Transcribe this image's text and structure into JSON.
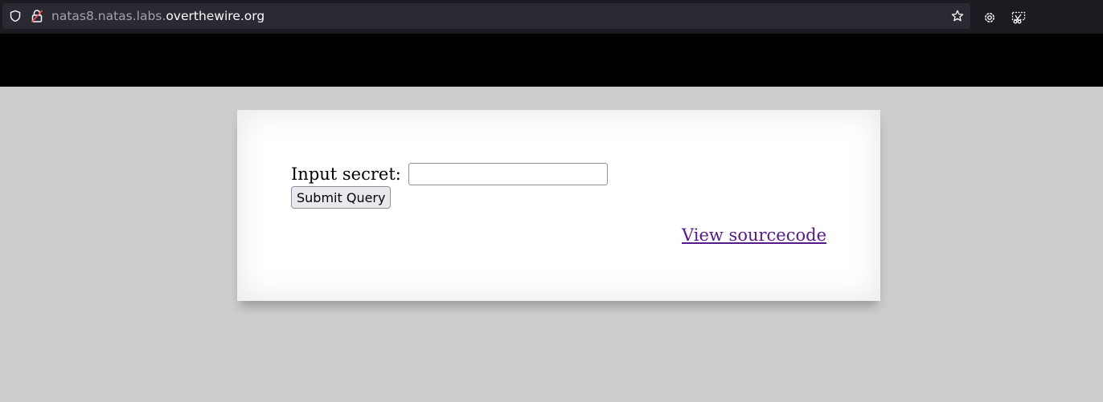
{
  "browser": {
    "url_subdomain": "natas8.natas.labs.",
    "url_domain": "overthewire.org"
  },
  "form": {
    "label": "Input secret:",
    "input_value": "",
    "submit_label": "Submit Query"
  },
  "links": {
    "view_source": "View sourcecode"
  },
  "colors": {
    "header": "#000000",
    "background": "#cccccc",
    "link": "#551a8b"
  }
}
